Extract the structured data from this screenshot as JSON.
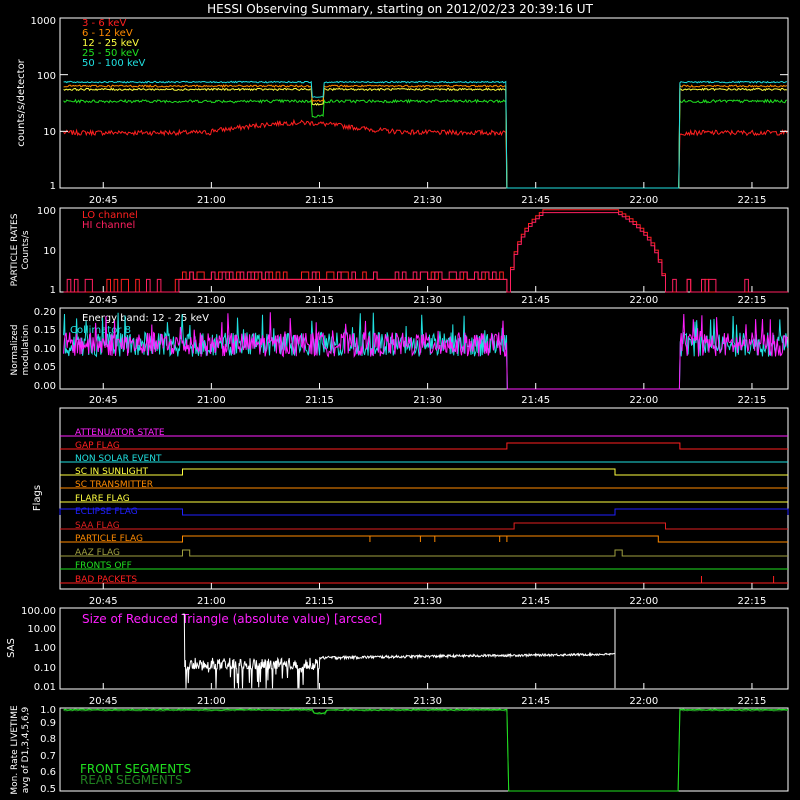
{
  "title": "HESSI Observing Summary, starting on 2012/02/23 20:39:16 UT",
  "time_ticks": [
    "20:45",
    "21:00",
    "21:15",
    "21:30",
    "21:45",
    "22:00",
    "22:15"
  ],
  "colors": {
    "red": "#ff2020",
    "orange": "#ff8a00",
    "yellow": "#ffff40",
    "green": "#20e020",
    "cyan": "#20e0e0",
    "magenta": "#ff20ff",
    "white": "#ffffff",
    "blue": "#2020ff",
    "pink": "#ff2060",
    "dkred": "#e02020",
    "olive": "#a0a040",
    "dkgreen": "#208020"
  },
  "chart_data": [
    {
      "type": "line",
      "name": "count-rates",
      "ylabel": "counts/s/detector",
      "yscale": "log",
      "ylim": [
        1,
        1000
      ],
      "yticks": [
        "1",
        "10",
        "100",
        "1000"
      ],
      "xlim_minutes_utc": [
        "20:39",
        "22:20"
      ],
      "gap": [
        "21:41",
        "22:05"
      ],
      "legend_position": "top-left",
      "series": [
        {
          "name": "3 - 6 keV",
          "color": "#ff2020",
          "approx_level": 10
        },
        {
          "name": "6 - 12 keV",
          "color": "#ff8a00",
          "approx_level": 65
        },
        {
          "name": "12 - 25 keV",
          "color": "#ffff40",
          "approx_level": 55
        },
        {
          "name": "25 - 50 keV",
          "color": "#20e020",
          "approx_level": 35
        },
        {
          "name": "50 - 100 keV",
          "color": "#20e0e0",
          "approx_level": 75
        }
      ]
    },
    {
      "type": "line",
      "name": "particle-rates",
      "ylabel": "PARTICLE RATES",
      "ylabel2": "Counts/s",
      "yscale": "log",
      "ylim": [
        1,
        100
      ],
      "yticks": [
        "1",
        "10",
        "100"
      ],
      "legend_position": "top-left",
      "series": [
        {
          "name": "LO channel",
          "color": "#ff2020"
        },
        {
          "name": "HI channel",
          "color": "#ff2060"
        }
      ]
    },
    {
      "type": "line",
      "name": "modulation",
      "ylabel": "Normalized",
      "ylabel2": "modulation",
      "ylim": [
        0.0,
        0.2
      ],
      "yticks": [
        "0.00",
        "0.05",
        "0.10",
        "0.15",
        "0.20"
      ],
      "annotation": "Energy band: 12 - 25 keV",
      "series": [
        {
          "name": "Collimator 8",
          "color": "#20e0e0"
        },
        {
          "name": "",
          "color": "#ff20ff"
        }
      ]
    },
    {
      "type": "line",
      "name": "flags",
      "ylabel": "Flags",
      "series": [
        {
          "name": "ATTENUATOR STATE",
          "color": "#ff20ff"
        },
        {
          "name": "GAP FLAG",
          "color": "#ff2020"
        },
        {
          "name": "NON SOLAR EVENT",
          "color": "#20e0e0"
        },
        {
          "name": "SC IN SUNLIGHT",
          "color": "#ffff40"
        },
        {
          "name": "SC TRANSMITTER",
          "color": "#ff8a00"
        },
        {
          "name": "FLARE FLAG",
          "color": "#ffff40"
        },
        {
          "name": "ECLIPSE FLAG",
          "color": "#2020ff"
        },
        {
          "name": "SAA FLAG",
          "color": "#e02020"
        },
        {
          "name": "PARTICLE FLAG",
          "color": "#ff8a00"
        },
        {
          "name": "AAZ FLAG",
          "color": "#a0a040"
        },
        {
          "name": "FRONTS OFF",
          "color": "#20e020"
        },
        {
          "name": "BAD PACKETS",
          "color": "#ff2020"
        }
      ]
    },
    {
      "type": "line",
      "name": "sas",
      "ylabel": "SAS",
      "yscale": "log",
      "ylim": [
        0.01,
        100
      ],
      "yticks": [
        "0.01",
        "0.10",
        "1.00",
        "10.00",
        "100.00"
      ],
      "annotation": "Size of Reduced Triangle (absolute value) [arcsec]",
      "series": [
        {
          "name": "",
          "color": "#ffffff"
        }
      ]
    },
    {
      "type": "line",
      "name": "livetime",
      "ylabel": "Mon. Rate LIVETIME",
      "ylabel2": "avg of D1,3,4,5,6,9",
      "ylim": [
        0.5,
        1.0
      ],
      "yticks": [
        "0.5",
        "0.6",
        "0.7",
        "0.8",
        "0.9",
        "1.0"
      ],
      "series": [
        {
          "name": "FRONT SEGMENTS",
          "color": "#20e020"
        },
        {
          "name": "REAR SEGMENTS",
          "color": "#208020"
        }
      ]
    }
  ]
}
